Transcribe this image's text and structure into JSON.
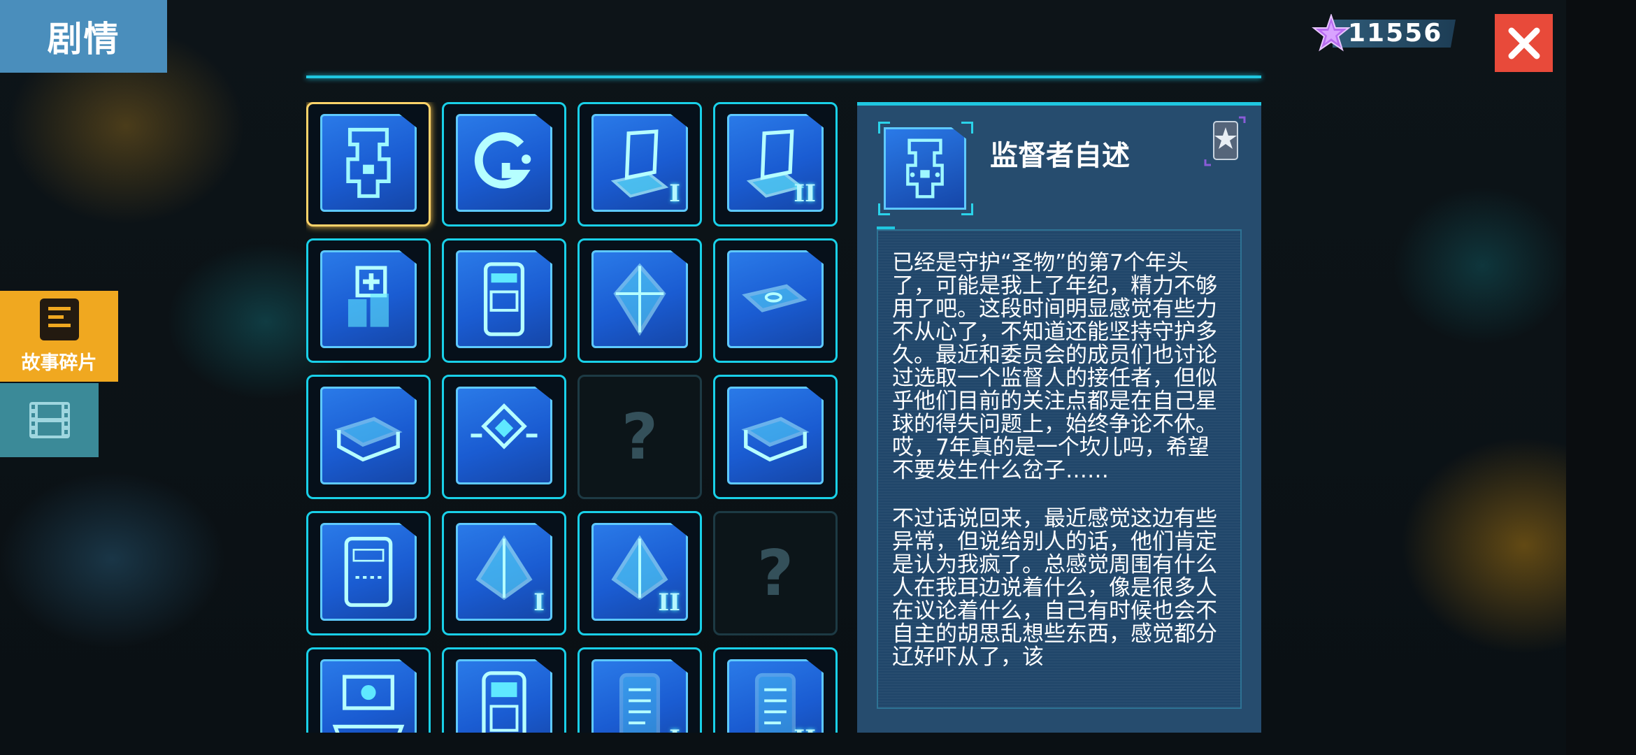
{
  "header": {
    "title": "剧情"
  },
  "currency": {
    "amount": "11556",
    "icon": "purple-star-gem-icon"
  },
  "close": {
    "icon": "close-icon"
  },
  "sidebar": {
    "tabs": [
      {
        "label": "故事碎片",
        "icon": "story-fragment-icon",
        "active": true
      },
      {
        "label": "",
        "icon": "film-icon",
        "active": false
      }
    ]
  },
  "fragments": [
    {
      "icon": "circuit-board-icon",
      "numeral": "",
      "unlocked": true,
      "selected": true
    },
    {
      "icon": "g-logo-icon",
      "numeral": "",
      "unlocked": true
    },
    {
      "icon": "laptop-icon",
      "numeral": "I",
      "unlocked": true
    },
    {
      "icon": "laptop-icon",
      "numeral": "II",
      "unlocked": true
    },
    {
      "icon": "medical-devices-icon",
      "numeral": "",
      "unlocked": true
    },
    {
      "icon": "scanner-device-icon",
      "numeral": "",
      "unlocked": true
    },
    {
      "icon": "crystal-icon",
      "numeral": "",
      "unlocked": true
    },
    {
      "icon": "usb-drive-icon",
      "numeral": "",
      "unlocked": true
    },
    {
      "icon": "book-icon",
      "numeral": "",
      "unlocked": true
    },
    {
      "icon": "emblem-icon",
      "numeral": "",
      "unlocked": true
    },
    {
      "icon": "question-icon",
      "numeral": "",
      "unlocked": false,
      "placeholder": "?"
    },
    {
      "icon": "book-icon",
      "numeral": "",
      "unlocked": true
    },
    {
      "icon": "tablet-book-icon",
      "numeral": "",
      "unlocked": true
    },
    {
      "icon": "pyramid-icon",
      "numeral": "I",
      "unlocked": true
    },
    {
      "icon": "pyramid-icon",
      "numeral": "II",
      "unlocked": true
    },
    {
      "icon": "question-icon",
      "numeral": "",
      "unlocked": false,
      "placeholder": "?"
    },
    {
      "icon": "hologram-projector-icon",
      "numeral": "",
      "unlocked": true
    },
    {
      "icon": "robot-terminal-icon",
      "numeral": "",
      "unlocked": true
    },
    {
      "icon": "document-icon",
      "numeral": "I",
      "unlocked": true
    },
    {
      "icon": "document-icon",
      "numeral": "II",
      "unlocked": true
    }
  ],
  "detail": {
    "title": "监督者自述",
    "icon": "circuit-board-icon",
    "medal_icon": "silver-star-medal-icon",
    "paragraphs": [
      "已经是守护“圣物”的第7个年头了，可能是我上了年纪，精力不够用了吧。这段时间明显感觉有些力不从心了，不知道还能坚持守护多久。最近和委员会的成员们也讨论过选取一个监督人的接任者，但似乎他们目前的关注点都是在自己星球的得失问题上，始终争论不休。哎，7年真的是一个坎儿吗，希望不要发生什么岔子……",
      "不过话说回来，最近感觉这边有些异常，但说给别人的话，他们肯定是认为我疯了。总感觉周围有什么人在我耳边说着什么，像是很多人在议论着什么，自己有时候也会不自主的胡思乱想些东西，感觉都分辽好吓从了，该"
    ]
  },
  "colors": {
    "accent": "#1fc7e0",
    "selected": "#ffd36a",
    "title_tab": "#4a8ebc",
    "story_tab": "#f0a820",
    "close": "#e84a3a"
  }
}
